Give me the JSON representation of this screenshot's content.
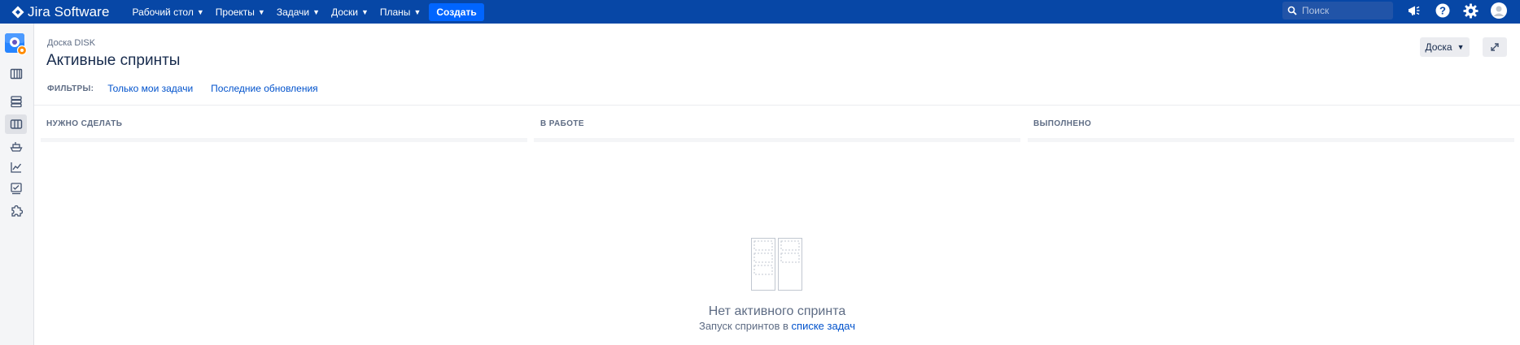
{
  "topnav": {
    "logo_text": "Jira Software",
    "menu": [
      {
        "label": "Рабочий стол"
      },
      {
        "label": "Проекты"
      },
      {
        "label": "Задачи"
      },
      {
        "label": "Доски"
      },
      {
        "label": "Планы"
      }
    ],
    "create_label": "Создать",
    "search_placeholder": "Поиск",
    "icons": [
      "megaphone-icon",
      "help-icon",
      "settings-icon",
      "avatar-icon"
    ]
  },
  "sidebar": {
    "items": [
      "project-avatar",
      "backlog-icon",
      "sprint-icon",
      "board-icon",
      "releases-icon",
      "reports-icon",
      "pages-icon",
      "addons-icon"
    ],
    "active": "board-icon"
  },
  "header": {
    "breadcrumb": "Доска DISK",
    "title": "Активные спринты",
    "board_button": "Доска"
  },
  "filters": {
    "label": "ФИЛЬТРЫ:",
    "links": [
      "Только мои задачи",
      "Последние обновления"
    ]
  },
  "columns": [
    {
      "title": "НУЖНО СДЕЛАТЬ"
    },
    {
      "title": "В РАБОТЕ"
    },
    {
      "title": "ВЫПОЛНЕНО"
    }
  ],
  "empty_state": {
    "title": "Нет активного спринта",
    "sub_prefix": "Запуск спринтов в ",
    "sub_link": "списке задач"
  },
  "colors": {
    "nav_bg": "#0747a6",
    "create_btn": "#0065ff",
    "link": "#0052cc"
  }
}
